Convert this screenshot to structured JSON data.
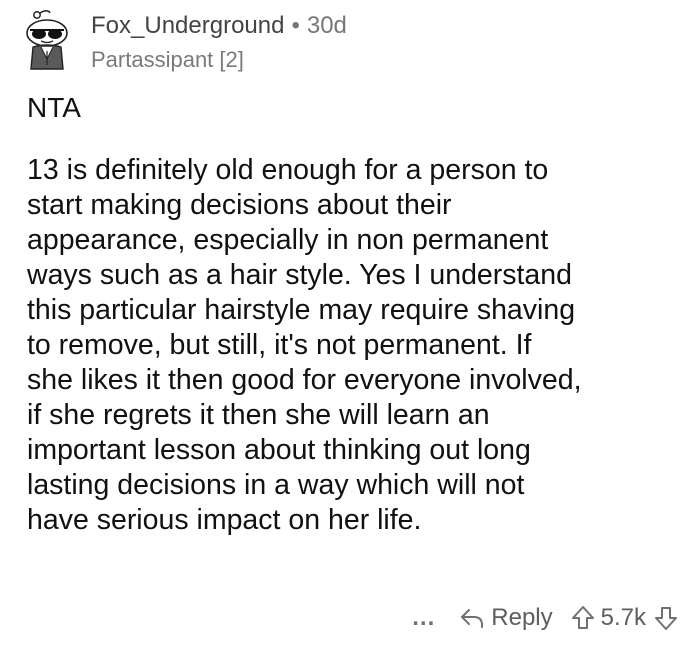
{
  "comment": {
    "author": "Fox_Underground",
    "separator": "•",
    "age": "30d",
    "flair": "Partassipant [2]",
    "verdict": "NTA",
    "body_lines": [
      "13 is definitely old enough for a person to",
      "start making decisions about their",
      "appearance, especially in non permanent",
      "ways such as a hair style. Yes I understand",
      "this particular hairstyle may require shaving",
      "to remove, but still, it's not permanent. If",
      "she likes it then good for everyone involved,",
      "if she regrets it then she will learn an",
      "important lesson about thinking out long",
      "lasting decisions in a way which will not",
      "have serious impact on her life."
    ]
  },
  "actions": {
    "more_label": "...",
    "reply_label": "Reply",
    "score": "5.7k"
  },
  "icons": {
    "avatar": "snoo-sunglasses-avatar",
    "reply": "reply-arrow-icon",
    "upvote": "upvote-arrow-icon",
    "downvote": "downvote-arrow-icon"
  },
  "colors": {
    "text": "#111111",
    "meta": "#707070"
  }
}
